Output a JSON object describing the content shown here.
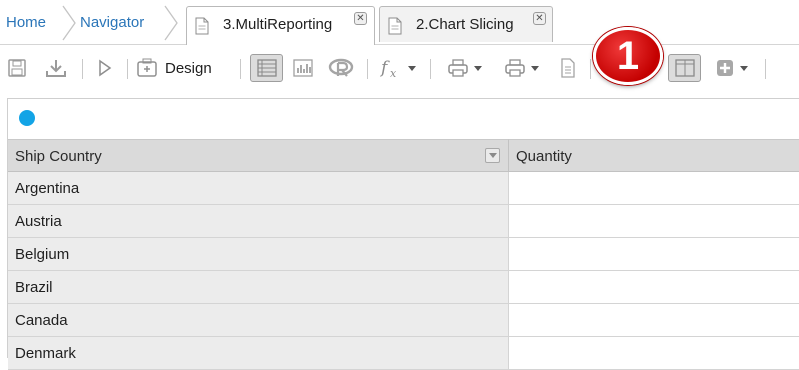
{
  "breadcrumbs": [
    {
      "label": "Home"
    },
    {
      "label": "Navigator"
    }
  ],
  "tabs": [
    {
      "label": "3.MultiReporting",
      "active": true,
      "close": "✕"
    },
    {
      "label": "2.Chart Slicing",
      "active": false,
      "close": "✕"
    }
  ],
  "toolbar": {
    "design_label": "Design",
    "icons": [
      "save-icon",
      "download-icon",
      "run-icon",
      "design-icon",
      "grid-view-icon",
      "chart-view-icon",
      "r-icon",
      "formula-icon",
      "print-icon",
      "export-icon",
      "document-icon",
      "split-view-icon",
      "add-icon"
    ]
  },
  "annotation": {
    "badge": "1",
    "color": "#d40000"
  },
  "grid": {
    "status_color": "#13a4e6",
    "columns": [
      "Ship Country",
      "Quantity"
    ],
    "rows": [
      [
        "Argentina",
        ""
      ],
      [
        "Austria",
        ""
      ],
      [
        "Belgium",
        ""
      ],
      [
        "Brazil",
        ""
      ],
      [
        "Canada",
        ""
      ],
      [
        "Denmark",
        ""
      ]
    ]
  }
}
